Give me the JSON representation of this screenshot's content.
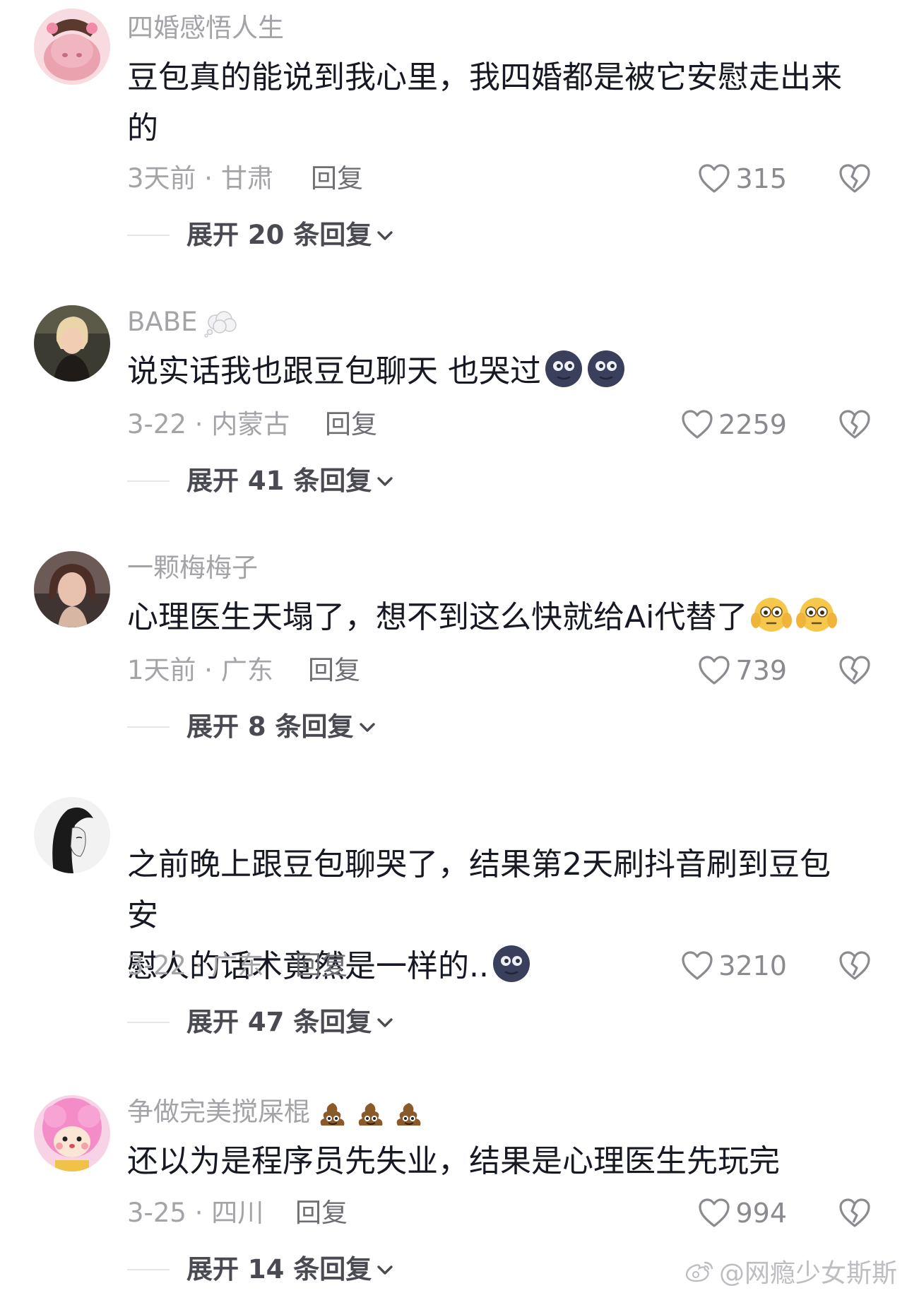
{
  "comments": [
    {
      "username": "四婚感悟人生",
      "text_line1": "豆包真的能说到我心里，我四婚都是被它安慰走出来",
      "text_line2": "的",
      "time_location": "3天前 · 甘肃",
      "reply_label": "回复",
      "likes": "315",
      "expand_label": "展开 20 条回复"
    },
    {
      "username": "BABE",
      "username_emoji": "thought-bubble-emoji",
      "text_line1": "说实话我也跟豆包聊天 也哭过",
      "text_emojis": [
        "new-moon-face-emoji",
        "new-moon-face-emoji"
      ],
      "time_location": "3-22 · 内蒙古",
      "reply_label": "回复",
      "likes": "2259",
      "expand_label": "展开 41 条回复"
    },
    {
      "username": "一颗梅梅子",
      "text_line1": "心理医生天塌了，想不到这么快就给Ai代替了",
      "text_emojis": [
        "flushed-hands-emoji",
        "flushed-hands-emoji"
      ],
      "time_location": "1天前 · 广东",
      "reply_label": "回复",
      "likes": "739",
      "expand_label": "展开 8 条回复"
    },
    {
      "username": "",
      "text_line1": "之前晚上跟豆包聊哭了，结果第2天刷抖音刷到豆包安",
      "text_line2": "慰人的话术竟然是一样的..",
      "text_emojis": [
        "new-moon-face-emoji"
      ],
      "time_location": "3-22 · 广东",
      "reply_label": "回复",
      "likes": "3210",
      "expand_label": "展开 47 条回复"
    },
    {
      "username": "争做完美搅屎棍",
      "username_emojis": [
        "poop-emoji",
        "poop-emoji",
        "poop-emoji"
      ],
      "text_line1": "还以为是程序员先失业，结果是心理医生先玩完",
      "time_location": "3-25 · 四川",
      "reply_label": "回复",
      "likes": "994",
      "expand_label": "展开 14 条回复"
    }
  ],
  "watermark": "@网瘾少女斯斯",
  "colors": {
    "text": "#161823",
    "secondary": "#a3a3a8",
    "background": "#ffffff"
  }
}
